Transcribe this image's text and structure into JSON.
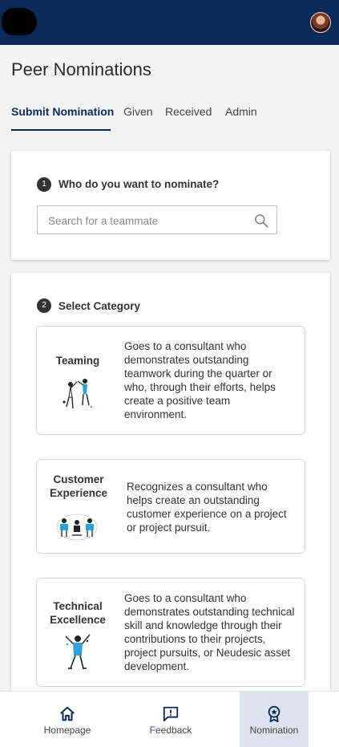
{
  "page": {
    "title": "Peer Nominations"
  },
  "tabs": [
    {
      "label": "Submit Nomination"
    },
    {
      "label": "Given"
    },
    {
      "label": "Received"
    },
    {
      "label": "Admin"
    }
  ],
  "step1": {
    "number": "1",
    "title": "Who do you want to nominate?",
    "search_placeholder": "Search for a teammate",
    "search_value": ""
  },
  "step2": {
    "number": "2",
    "title": "Select Category",
    "categories": [
      {
        "name": "Teaming",
        "description": "Goes to a consultant who demonstrates outstanding teamwork during the quarter or who, through their efforts, helps create a positive team environment.",
        "illustration": "high-five-illustration"
      },
      {
        "name": "Customer Experience",
        "description": "Recognizes a consultant who helps create an outstanding customer experience on a project or project pursuit.",
        "illustration": "meeting-illustration"
      },
      {
        "name": "Technical Excellence",
        "description": "Goes to a consultant who demonstrates outstanding technical skill and knowledge through their contributions to their projects, project pursuits, or Neudesic asset development.",
        "illustration": "celebrating-person-illustration"
      }
    ]
  },
  "bottom_nav": [
    {
      "label": "Homepage",
      "icon": "home-icon"
    },
    {
      "label": "Feedback",
      "icon": "feedback-icon"
    },
    {
      "label": "Nomination",
      "icon": "award-icon"
    }
  ],
  "colors": {
    "brand_navy": "#0b2a5a",
    "accent_blue": "#2aa3dc",
    "active_nav_bg": "#dde3ec"
  }
}
